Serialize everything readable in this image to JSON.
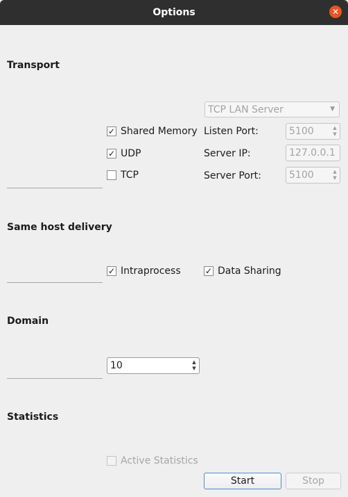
{
  "window": {
    "title": "Options"
  },
  "transport": {
    "title": "Transport",
    "mode": "TCP LAN Server",
    "shared_memory": {
      "label": "Shared Memory",
      "checked": true
    },
    "udp": {
      "label": "UDP",
      "checked": true
    },
    "tcp": {
      "label": "TCP",
      "checked": false
    },
    "listen_port": {
      "label": "Listen Port:",
      "value": "5100"
    },
    "server_ip": {
      "label": "Server IP:",
      "value": "127.0.0.1"
    },
    "server_port": {
      "label": "Server Port:",
      "value": "5100"
    }
  },
  "same_host": {
    "title": "Same host delivery",
    "intraprocess": {
      "label": "Intraprocess",
      "checked": true
    },
    "data_sharing": {
      "label": "Data Sharing",
      "checked": true
    }
  },
  "domain": {
    "title": "Domain",
    "value": "10"
  },
  "statistics": {
    "title": "Statistics",
    "active": {
      "label": "Active Statistics",
      "checked": false
    }
  },
  "buttons": {
    "start": "Start",
    "stop": "Stop"
  },
  "glyphs": {
    "check": "✓",
    "close": "✕",
    "down": "▼",
    "up": "▲"
  }
}
